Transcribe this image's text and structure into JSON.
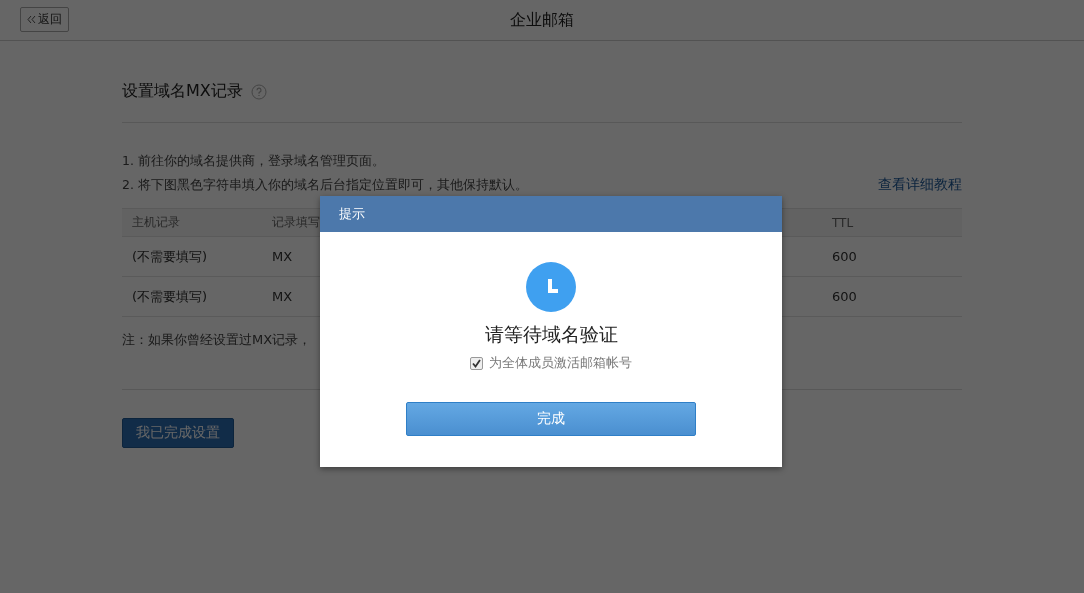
{
  "header": {
    "back_label": "返回",
    "title": "企业邮箱"
  },
  "section": {
    "title": "设置域名MX记录",
    "steps": [
      "1. 前往你的域名提供商，登录域名管理页面。",
      "2. 将下图黑色字符串填入你的域名后台指定位置即可，其他保持默认。"
    ],
    "tutorial_link": "查看详细教程"
  },
  "table": {
    "columns": [
      "主机记录",
      "记录填写",
      "TTL"
    ],
    "rows": [
      [
        "(不需要填写)",
        "MX",
        "600"
      ],
      [
        "(不需要填写)",
        "MX",
        "600"
      ]
    ]
  },
  "note": "注：如果你曾经设置过MX记录，",
  "done_button": "我已完成设置",
  "dialog": {
    "title": "提示",
    "message": "请等待域名验证",
    "checkbox": {
      "label": "为全体成员激活邮箱帐号",
      "checked": true
    },
    "confirm_button": "完成"
  }
}
